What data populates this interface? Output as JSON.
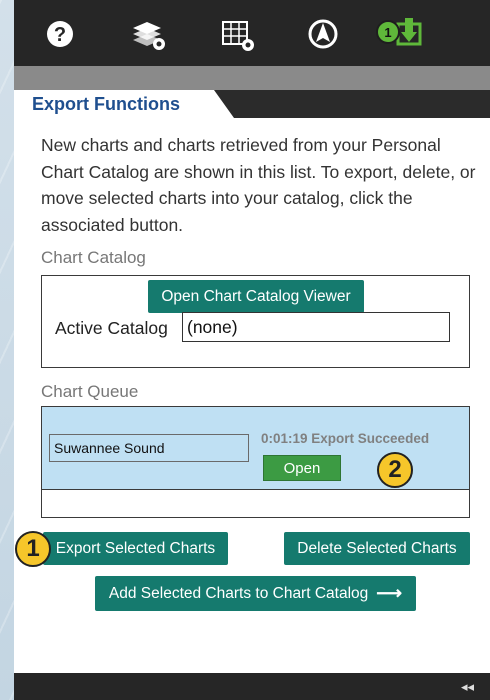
{
  "toolbar": {
    "help_icon": "question-circle-icon",
    "layers_icon": "layers-settings-icon",
    "grid_icon": "grid-settings-icon",
    "compass_icon": "compass-arrow-icon",
    "export_icon": "export-download-icon",
    "export_badge": "1",
    "badge_color": "#5fb83a"
  },
  "panel": {
    "tab_title": "Export Functions",
    "description": "New charts and charts retrieved from your Personal Chart Catalog are shown in this list. To export, delete, or move selected charts into your catalog, click the associated button."
  },
  "catalog": {
    "label": "Chart Catalog",
    "open_viewer_label": "Open Chart Catalog Viewer",
    "active_label": "Active Catalog",
    "active_value": "(none)"
  },
  "queue": {
    "label": "Chart Queue",
    "items": [
      {
        "name": "Suwannee Sound",
        "status": "0:01:19 Export Succeeded",
        "open_label": "Open"
      }
    ]
  },
  "actions": {
    "export_label": "Export Selected Charts",
    "delete_label": "Delete Selected Charts",
    "add_label": "Add Selected Charts to Chart Catalog",
    "add_arrow": "⟶"
  },
  "callouts": {
    "one": "1",
    "two": "2"
  },
  "footer": {
    "collapse_glyph": "◂◂"
  },
  "colors": {
    "accent_teal": "#157a6e",
    "title_blue": "#1f4f8f",
    "queue_highlight": "#bfe0f3",
    "open_green": "#3c9b43",
    "callout_yellow": "#f6c62a"
  }
}
